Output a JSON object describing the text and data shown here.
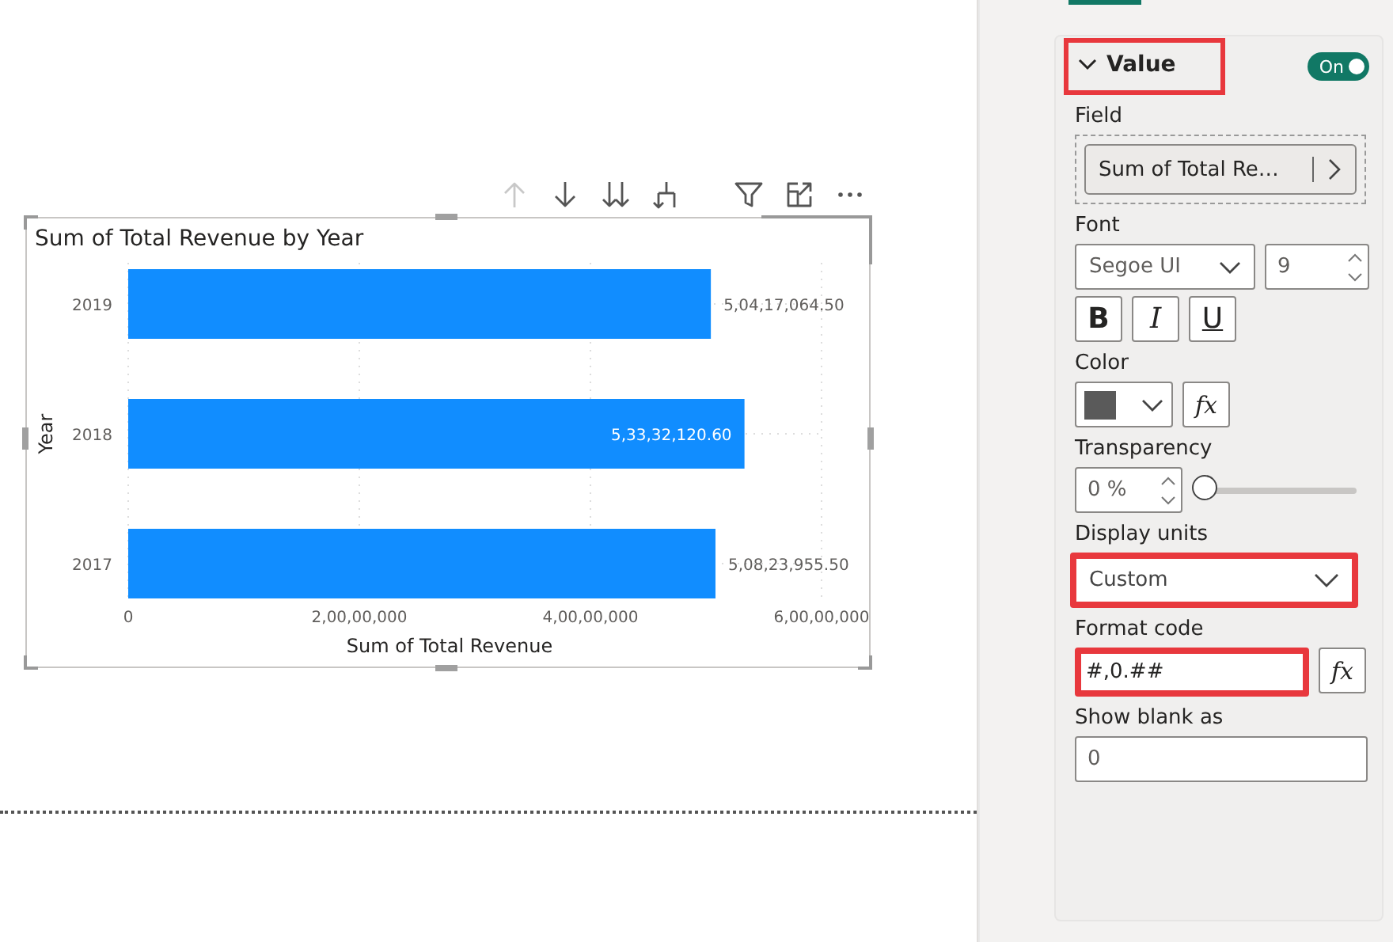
{
  "visual_toolbar": [
    {
      "kind": "drill-up",
      "disabled": true
    },
    {
      "kind": "drill-down",
      "disabled": false
    },
    {
      "kind": "expand-all",
      "disabled": false
    },
    {
      "kind": "expand-hierarchy",
      "disabled": false
    },
    {
      "kind": "filter",
      "disabled": false
    },
    {
      "kind": "focus",
      "disabled": false
    },
    {
      "kind": "more",
      "disabled": false
    }
  ],
  "chart": {
    "chart_data": {
      "type": "bar",
      "orientation": "horizontal",
      "title": "Sum of Total Revenue by Year",
      "xlabel": "Sum of Total Revenue",
      "ylabel": "Year",
      "categories": [
        "2019",
        "2018",
        "2017"
      ],
      "series": [
        {
          "color": "#118dff",
          "values": [
            50420000,
            53330000,
            50820000
          ]
        }
      ],
      "value_labels": [
        "5,04,17,064.50",
        "5,33,32,120.60",
        "5,08,23,955.50"
      ],
      "xlim": [
        0,
        60000000
      ],
      "xticks": [
        {
          "value": 0,
          "label": "0"
        },
        {
          "value": 20000000,
          "label": "2,00,00,000"
        },
        {
          "value": 40000000,
          "label": "4,00,00,000"
        },
        {
          "value": 60000000,
          "label": "6,00,00,000"
        }
      ]
    }
  },
  "format_pane": {
    "value_section": {
      "title": "Value",
      "expanded": true,
      "highlighted": true,
      "toggle": {
        "label": "On",
        "on": true
      }
    },
    "field": {
      "label": "Field",
      "value": "Sum of Total Re…"
    },
    "font": {
      "label": "Font",
      "family": "Segoe UI",
      "size": "9",
      "styles": [
        {
          "kind": "bold",
          "label": "B",
          "selected": false
        },
        {
          "kind": "italic",
          "label": "I",
          "selected": false
        },
        {
          "kind": "underline",
          "label": "U",
          "selected": false
        }
      ]
    },
    "color": {
      "label": "Color",
      "color": "#5a5a5a",
      "fx": "fx"
    },
    "transparency": {
      "label": "Transparency",
      "value": "0 %",
      "level": 0
    },
    "display_units": {
      "label": "Display units",
      "value": "Custom",
      "highlighted": true
    },
    "format_code": {
      "label": "Format code",
      "value": "#,0.##",
      "highlighted": true,
      "fx": "fx"
    },
    "show_blank_as": {
      "label": "Show blank as",
      "value": "0"
    }
  }
}
